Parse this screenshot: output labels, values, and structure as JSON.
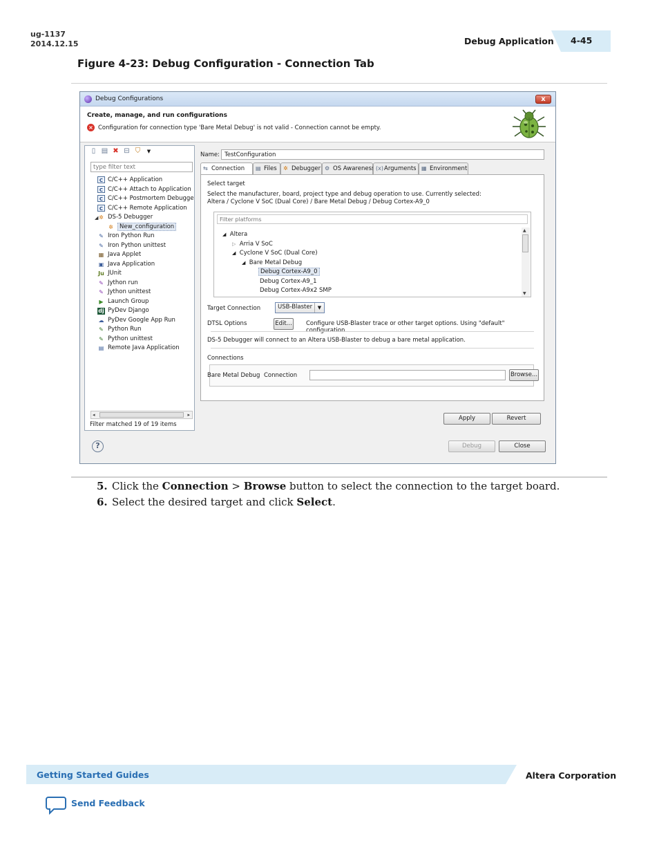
{
  "header": {
    "doc_id": "ug-1137",
    "doc_date": "2014.12.15",
    "section": "Debug Application",
    "page_number": "4-45"
  },
  "figure_title": "Figure 4-23: Debug Configuration - Connection Tab",
  "dialog": {
    "title": "Debug Configurations",
    "close_label": "x",
    "banner_heading": "Create, manage, and run configurations",
    "banner_error": "Configuration for connection type 'Bare Metal Debug' is not valid - Connection cannot be empty.",
    "left": {
      "filter_placeholder": "type filter text",
      "tree": [
        {
          "label": "C/C++ Application",
          "icon": "c-icon",
          "level": 1
        },
        {
          "label": "C/C++ Attach to Application",
          "icon": "c-icon",
          "level": 1
        },
        {
          "label": "C/C++ Postmortem Debugge",
          "icon": "c-icon",
          "level": 1
        },
        {
          "label": "C/C++ Remote Application",
          "icon": "c-icon",
          "level": 1
        },
        {
          "label": "DS-5 Debugger",
          "icon": "gear-icon",
          "level": 0
        },
        {
          "label": "New_configuration",
          "icon": "gear-icon",
          "level": 2
        },
        {
          "label": "Iron Python Run",
          "icon": "python-icon",
          "level": 1
        },
        {
          "label": "Iron Python unittest",
          "icon": "python-icon",
          "level": 1
        },
        {
          "label": "Java Applet",
          "icon": "applet-icon",
          "level": 1
        },
        {
          "label": "Java Application",
          "icon": "java-icon",
          "level": 1
        },
        {
          "label": "JUnit",
          "icon": "junit-icon",
          "level": 1
        },
        {
          "label": "Jython run",
          "icon": "jython-icon",
          "level": 1
        },
        {
          "label": "Jython unittest",
          "icon": "jython-icon",
          "level": 1
        },
        {
          "label": "Launch Group",
          "icon": "launch-icon",
          "level": 1
        },
        {
          "label": "PyDev Django",
          "icon": "django-icon",
          "level": 1
        },
        {
          "label": "PyDev Google App Run",
          "icon": "google-icon",
          "level": 1
        },
        {
          "label": "Python Run",
          "icon": "python-icon",
          "level": 1
        },
        {
          "label": "Python unittest",
          "icon": "python-icon",
          "level": 1
        },
        {
          "label": "Remote Java Application",
          "icon": "remote-icon",
          "level": 1
        }
      ],
      "footer": "Filter matched 19 of 19 items"
    },
    "right": {
      "name_label": "Name:",
      "name_value": "TestConfiguration",
      "tabs": [
        {
          "label": "Connection",
          "active": true
        },
        {
          "label": "Files",
          "active": false
        },
        {
          "label": "Debugger",
          "active": false
        },
        {
          "label": "OS Awareness",
          "active": false
        },
        {
          "label": "Arguments",
          "active": false
        },
        {
          "label": "Environment",
          "active": false
        }
      ],
      "select_target_label": "Select target",
      "select_target_desc": "Select the manufacturer, board, project type and debug operation to use. Currently selected:",
      "select_target_current": "Altera / Cyclone V SoC (Dual Core) / Bare Metal Debug / Debug Cortex-A9_0",
      "platform_filter_placeholder": "Filter platforms",
      "platform_tree": [
        "Altera",
        "Arria V SoC",
        "Cyclone V SoC (Dual Core)",
        "Bare Metal Debug",
        "Debug Cortex-A9_0",
        "Debug Cortex-A9_1",
        "Debug Cortex-A9x2 SMP"
      ],
      "target_connection_label": "Target Connection",
      "target_connection_value": "USB-Blaster",
      "dtsl_label": "DTSL Options",
      "dtsl_button": "Edit...",
      "dtsl_desc": "Configure USB-Blaster trace or other target options. Using \"default\" configuration",
      "info_line": "DS-5 Debugger will connect to an Altera USB-Blaster to debug a bare metal application.",
      "connections_label": "Connections",
      "bare_metal_label": "Bare Metal Debug",
      "connection_label": "Connection",
      "browse_button": "Browse...",
      "apply_button": "Apply",
      "revert_button": "Revert"
    },
    "debug_button": "Debug",
    "close_button": "Close"
  },
  "steps": [
    {
      "num": "5.",
      "pre": "Click the ",
      "b1": "Connection",
      "mid": " > ",
      "b2": "Browse",
      "post": " button to select the connection to the target board."
    },
    {
      "num": "6.",
      "pre": "Select the desired target and click ",
      "b1": "Select",
      "post": "."
    }
  ],
  "footer": {
    "guides": "Getting Started Guides",
    "corp": "Altera Corporation",
    "feedback": "Send Feedback"
  },
  "colors": {
    "accent_blue": "#2a6fb3",
    "band_blue": "#d8ecf7",
    "error_red": "#d9342b"
  }
}
